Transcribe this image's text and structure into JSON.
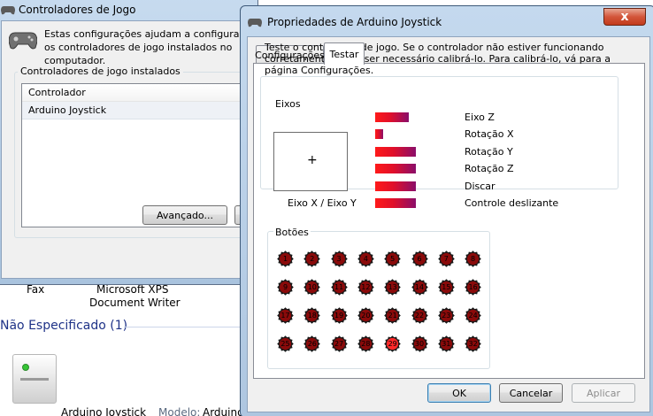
{
  "background": {
    "printer_labels": [
      "Fax",
      "Microsoft XPS",
      "Document Writer"
    ],
    "section_title": "Não Especificado (1)",
    "device_name": "Arduino Joystick",
    "device_model_label": "Modelo:",
    "device_model_value": "Arduino"
  },
  "game_controllers": {
    "title": "Controladores de Jogo",
    "description": "Estas configurações ajudam a configurar os controladores de jogo instalados no computador.",
    "group_label": "Controladores de jogo instalados",
    "list_header": "Controlador",
    "list_items": [
      "Arduino Joystick"
    ],
    "advanced_button": "Avançado..."
  },
  "properties": {
    "title": "Propriedades de Arduino Joystick",
    "close_glyph": "x",
    "tabs": [
      {
        "label": "Configurações",
        "selected": false
      },
      {
        "label": "Testar",
        "selected": true
      }
    ],
    "description": "Teste o controlador de jogo. Se o controlador não estiver funcionando corretamente, pode ser necessário calibrá-lo. Para calibrá-lo, vá para a página Configurações.",
    "axes_group_label": "Eixos",
    "xy_label": "Eixo X / Eixo Y",
    "xy_crosshair": "+",
    "axes": [
      {
        "label": "Eixo Z",
        "level": 0.51
      },
      {
        "label": "Rotação X",
        "level": 0.12
      },
      {
        "label": "Rotação Y",
        "level": 0.62
      },
      {
        "label": "Rotação Z",
        "level": 0.62
      },
      {
        "label": "Discar",
        "level": 0.62
      },
      {
        "label": "Controle deslizante",
        "level": 0.62
      }
    ],
    "buttons_group_label": "Botões",
    "buttons": [
      {
        "n": "1",
        "pressed": false
      },
      {
        "n": "2",
        "pressed": false
      },
      {
        "n": "3",
        "pressed": false
      },
      {
        "n": "4",
        "pressed": false
      },
      {
        "n": "5",
        "pressed": false
      },
      {
        "n": "6",
        "pressed": false
      },
      {
        "n": "7",
        "pressed": false
      },
      {
        "n": "8",
        "pressed": false
      },
      {
        "n": "9",
        "pressed": false
      },
      {
        "n": "10",
        "pressed": false
      },
      {
        "n": "11",
        "pressed": false
      },
      {
        "n": "12",
        "pressed": false
      },
      {
        "n": "13",
        "pressed": false
      },
      {
        "n": "14",
        "pressed": false
      },
      {
        "n": "15",
        "pressed": false
      },
      {
        "n": "16",
        "pressed": false
      },
      {
        "n": "17",
        "pressed": false
      },
      {
        "n": "18",
        "pressed": false
      },
      {
        "n": "19",
        "pressed": false
      },
      {
        "n": "20",
        "pressed": false
      },
      {
        "n": "21",
        "pressed": false
      },
      {
        "n": "22",
        "pressed": false
      },
      {
        "n": "23",
        "pressed": false
      },
      {
        "n": "24",
        "pressed": false
      },
      {
        "n": "25",
        "pressed": false
      },
      {
        "n": "26",
        "pressed": false
      },
      {
        "n": "27",
        "pressed": false
      },
      {
        "n": "28",
        "pressed": false
      },
      {
        "n": "29",
        "pressed": true
      },
      {
        "n": "30",
        "pressed": false
      },
      {
        "n": "31",
        "pressed": false
      },
      {
        "n": "32",
        "pressed": false
      }
    ],
    "ok_button": "OK",
    "cancel_button": "Cancelar",
    "apply_button": "Aplicar"
  },
  "colors": {
    "button_idle": "#8a0a0a",
    "button_pressed": "#ff2a2a",
    "axis_bar_start": "#ff1a1a",
    "axis_bar_end": "#8a0e6a"
  }
}
